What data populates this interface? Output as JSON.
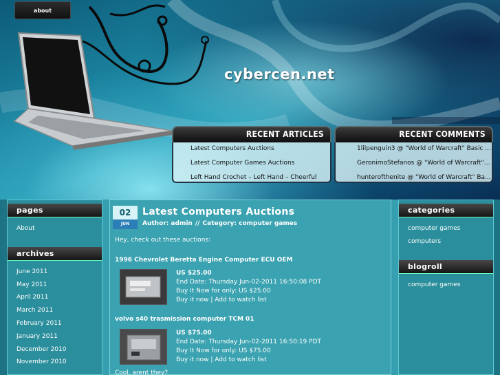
{
  "header": {
    "about_label": "about",
    "site_title": "cybercen.net",
    "recent_articles": {
      "title": "RECENT ARTICLES",
      "items": [
        "Latest Computers Auctions",
        "Latest Computer Games Auctions",
        "Left Hand Crochet – Left Hand – Cheerful Crochet Flower"
      ]
    },
    "recent_comments": {
      "title": "RECENT COMMENTS",
      "items": [
        "1lilpenguin3 @ \"World of Warcraft\" Basic ...",
        "GeronimoStefanos @ \"World of Warcraft\" B...",
        "hunterofthenite @ \"World of Warcraft\" Ba..."
      ]
    }
  },
  "sidebar_left": {
    "pages": {
      "title": "pages",
      "items": [
        "About"
      ]
    },
    "archives": {
      "title": "archives",
      "items": [
        "June 2011",
        "May 2011",
        "April 2011",
        "March 2011",
        "February 2011",
        "January 2011",
        "December 2010",
        "November 2010"
      ]
    }
  },
  "sidebar_right": {
    "categories": {
      "title": "categories",
      "items": [
        "computer games",
        "computers"
      ]
    },
    "blogroll": {
      "title": "blogroll",
      "items": [
        "computer games"
      ]
    }
  },
  "post": {
    "day": "02",
    "month": "JUN",
    "title": "Latest Computers Auctions",
    "meta_author": "Author: admin",
    "meta_sep": "//",
    "meta_category": "Category: computer games",
    "intro": "Hey, check out these auctions:",
    "items": [
      {
        "title": "1996 Chevrolet Beretta Engine Computer ECU OEM",
        "price": "US $25.00",
        "end_date": "End Date: Thursday Jun-02-2011 16:50:08 PDT",
        "buy_it_now": "Buy It Now for only: US $25.00",
        "actions": "Buy it now | Add to watch list"
      },
      {
        "title": "volvo s40 trasmission computer TCM 01",
        "price": "US $75.00",
        "end_date": "End Date: Thursday Jun-02-2011 16:50:19 PDT",
        "buy_it_now": "Buy It Now for only: US $75.00",
        "actions": "Buy it now | Add to watch list"
      }
    ],
    "outro": "Cool, arent they?"
  }
}
